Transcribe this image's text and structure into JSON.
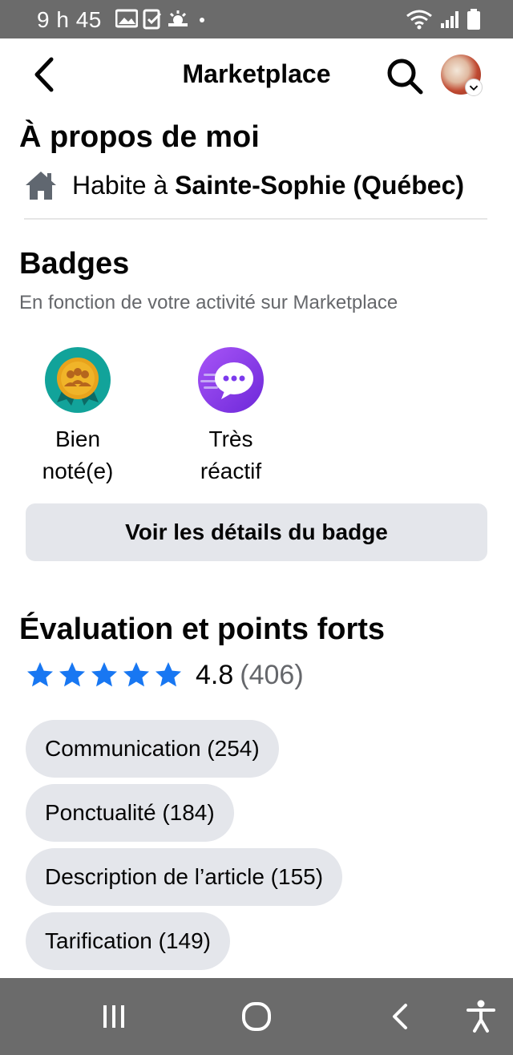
{
  "status_bar": {
    "time": "9 h 45",
    "icons_left": [
      "gallery-icon",
      "check-icon",
      "weather-icon",
      "dot-icon"
    ],
    "icons_right": [
      "wifi-icon",
      "signal-icon",
      "battery-icon"
    ]
  },
  "header": {
    "title": "Marketplace",
    "back_icon": "back-chevron-icon",
    "search_icon": "search-icon"
  },
  "about": {
    "heading": "À propos de moi",
    "lives_in_prefix": "Habite à ",
    "city": "Sainte-Sophie (Québec)"
  },
  "badges": {
    "heading": "Badges",
    "subtitle": "En fonction de votre activité sur Marketplace",
    "items": [
      {
        "label_line1": "Bien",
        "label_line2": "noté(e)",
        "icon": "highly-rated-badge-icon",
        "color": "#12a39a"
      },
      {
        "label_line1": "Très",
        "label_line2": "réactif",
        "icon": "very-responsive-badge-icon",
        "color": "#8a2be2"
      }
    ],
    "details_button": "Voir les détails du badge"
  },
  "rating": {
    "heading": "Évaluation et points forts",
    "stars": 5,
    "value": "4.8",
    "count": "(406)",
    "star_color": "#1877f2"
  },
  "strengths": [
    {
      "label": "Communication (254)"
    },
    {
      "label": "Ponctualité (184)"
    },
    {
      "label": "Description de l’article (155)"
    },
    {
      "label": "Tarification (149)"
    }
  ],
  "nav": {
    "recent_icon": "recent-apps-icon",
    "home_icon": "home-circle-icon",
    "back_icon": "nav-back-icon",
    "accessibility_icon": "accessibility-icon"
  }
}
